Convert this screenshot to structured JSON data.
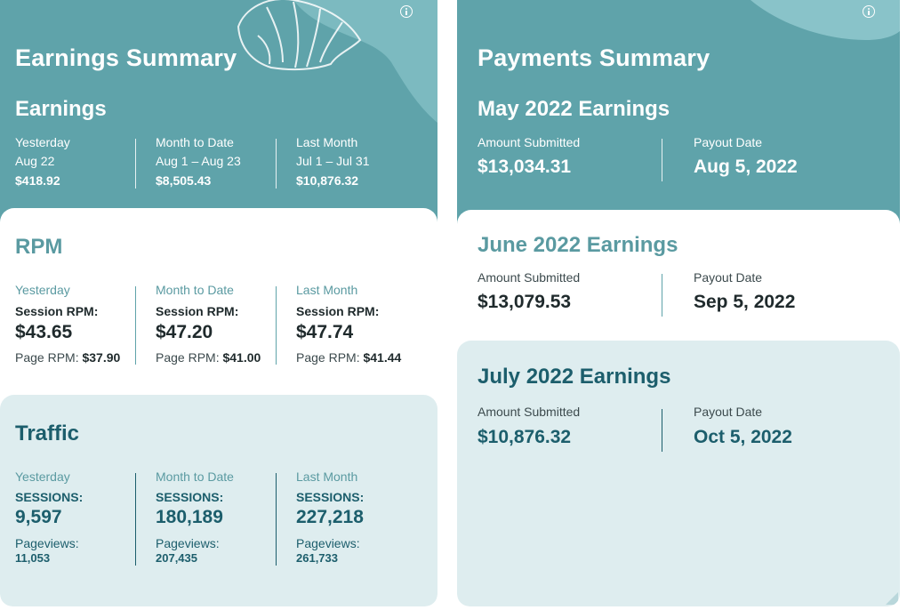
{
  "earnings_summary": {
    "title": "Earnings Summary",
    "earnings": {
      "heading": "Earnings",
      "cols": [
        {
          "period": "Yesterday",
          "range": "Aug 22",
          "value": "$418.92"
        },
        {
          "period": "Month to Date",
          "range": "Aug 1 – Aug 23",
          "value": "$8,505.43"
        },
        {
          "period": "Last Month",
          "range": "Jul 1 – Jul 31",
          "value": "$10,876.32"
        }
      ]
    },
    "rpm": {
      "heading": "RPM",
      "session_label": "Session RPM:",
      "page_label": "Page RPM:",
      "cols": [
        {
          "period": "Yesterday",
          "session_value": "$43.65",
          "page_value": "$37.90"
        },
        {
          "period": "Month to Date",
          "session_value": "$47.20",
          "page_value": "$41.00"
        },
        {
          "period": "Last Month",
          "session_value": "$47.74",
          "page_value": "$41.44"
        }
      ]
    },
    "traffic": {
      "heading": "Traffic",
      "sessions_label": "SESSIONS:",
      "pageviews_label": "Pageviews:",
      "cols": [
        {
          "period": "Yesterday",
          "sessions": "9,597",
          "pageviews": "11,053"
        },
        {
          "period": "Month to Date",
          "sessions": "180,189",
          "pageviews": "207,435"
        },
        {
          "period": "Last Month",
          "sessions": "227,218",
          "pageviews": "261,733"
        }
      ]
    }
  },
  "payments_summary": {
    "title": "Payments Summary",
    "amount_label": "Amount Submitted",
    "payout_label": "Payout Date",
    "months": [
      {
        "heading": "May 2022 Earnings",
        "amount": "$13,034.31",
        "payout_date": "Aug 5, 2022"
      },
      {
        "heading": "June 2022 Earnings",
        "amount": "$13,079.53",
        "payout_date": "Sep 5, 2022"
      },
      {
        "heading": "July 2022 Earnings",
        "amount": "$10,876.32",
        "payout_date": "Oct 5, 2022"
      }
    ]
  },
  "colors": {
    "teal_header": "#5fa3aa",
    "light_panel": "#deedef",
    "navy_text": "#1c5e6c",
    "teal_text": "#5a9aa1",
    "dark_text": "#1f2a2c"
  },
  "icons": [
    "info-icon",
    "monstera-leaf-decoration"
  ]
}
